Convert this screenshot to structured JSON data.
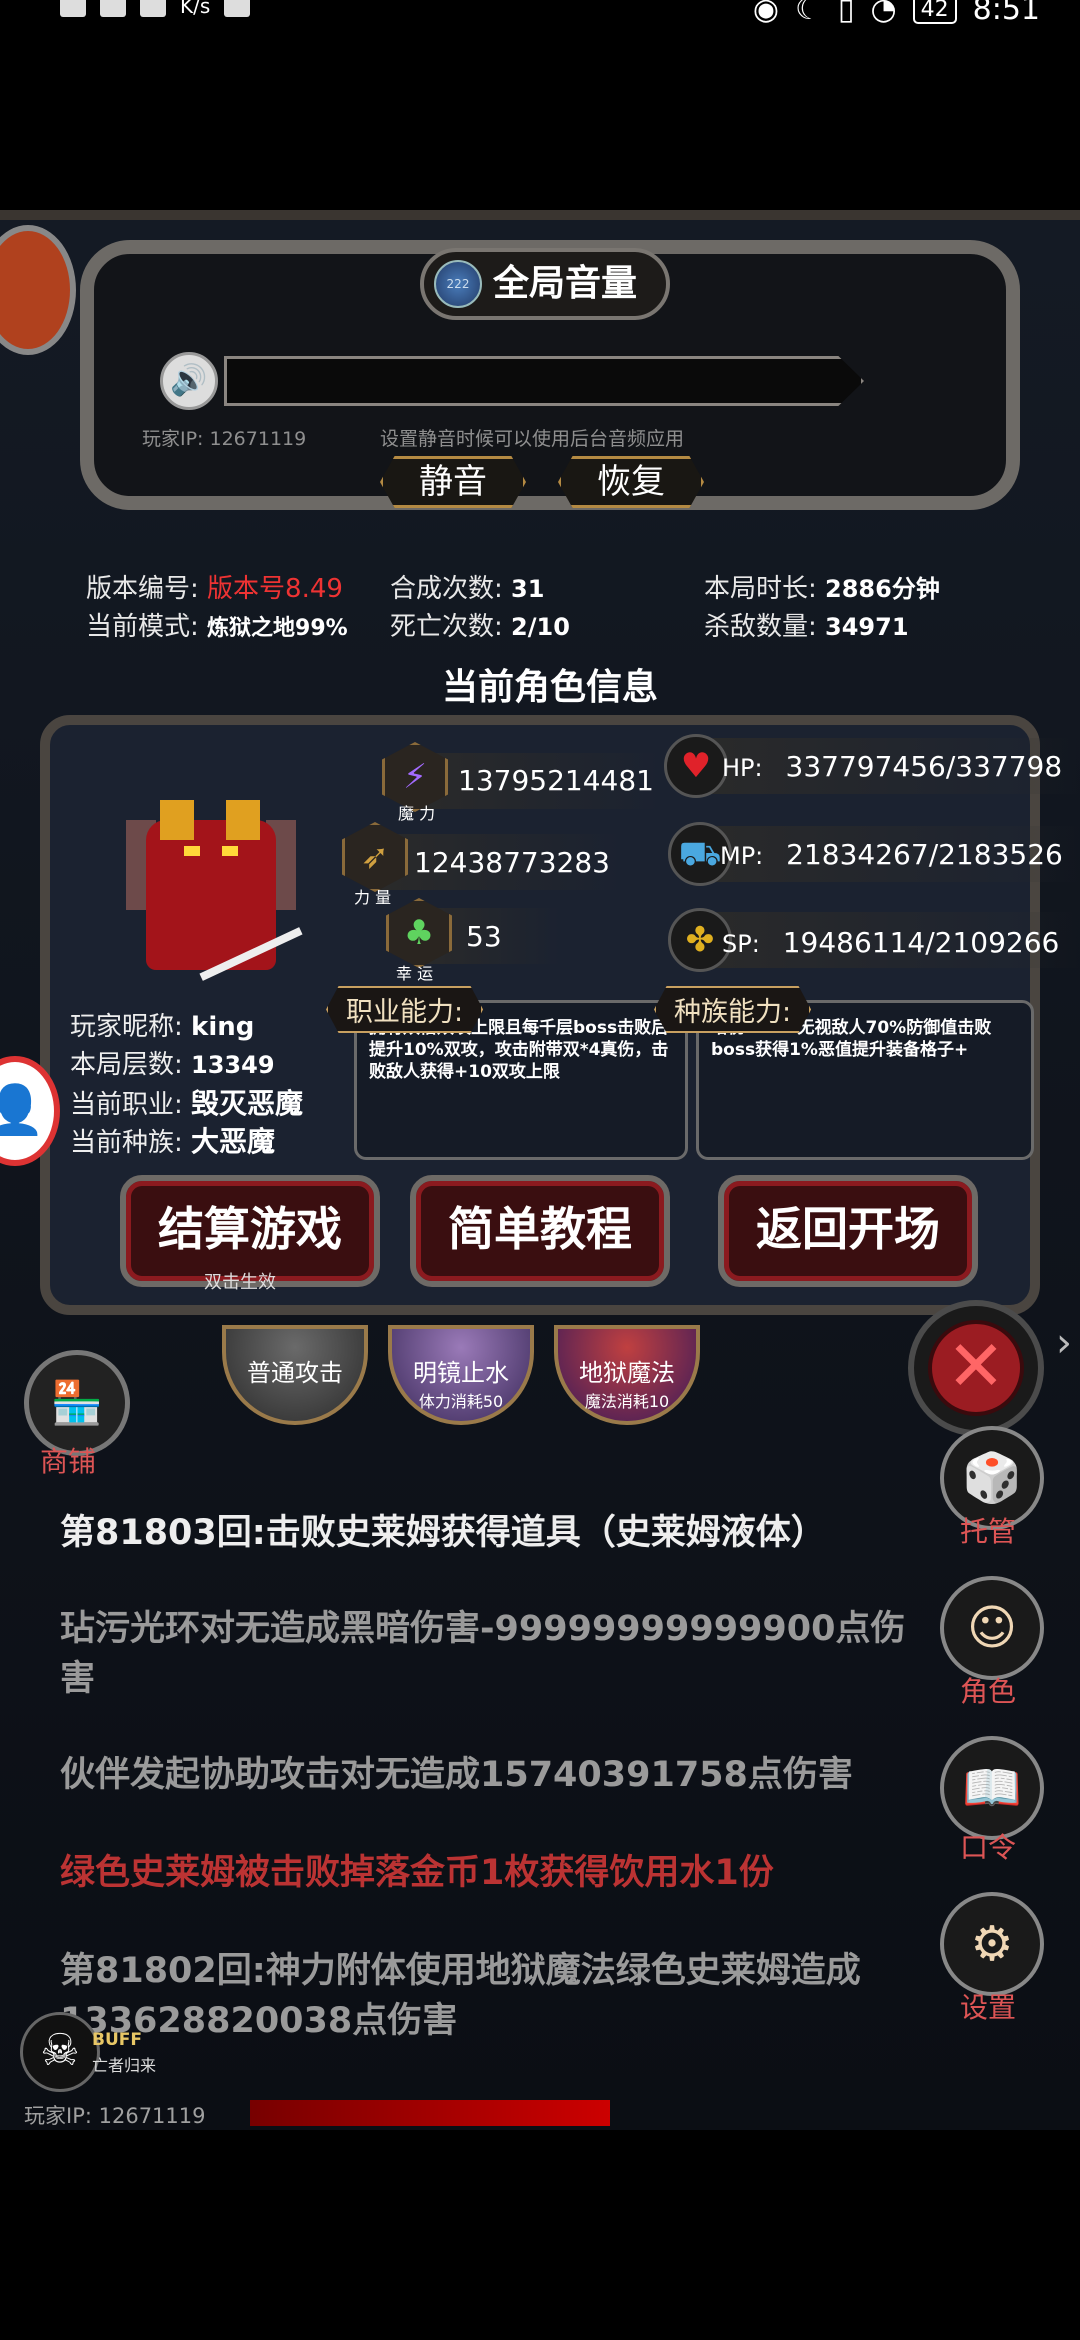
{
  "status_bar": {
    "net_speed": "K/s",
    "time": "8:51",
    "battery": "42"
  },
  "volume": {
    "title": "全局音量",
    "badge": "222",
    "player_ip": "玩家IP:  12671119",
    "hint": "设置静音时候可以使用后台音频应用",
    "mute_label": "静音",
    "restore_label": "恢复"
  },
  "stats": {
    "version_label": "版本编号:",
    "version_value": "版本号8.49",
    "merge_label": "合成次数:",
    "merge_value": "31",
    "duration_label": "本局时长:",
    "duration_value": "2886分钟",
    "mode_label": "当前模式:",
    "mode_value": "炼狱之地99%",
    "death_label": "死亡次数:",
    "death_value": "2/10",
    "kill_label": "杀敌数量:",
    "kill_value": "34971"
  },
  "character": {
    "section_title": "当前角色信息",
    "magic_value": "13795214481",
    "magic_caption": "魔 力",
    "strength_value": "12438773283",
    "strength_caption": "力 量",
    "luck_value": "53",
    "luck_caption": "幸 运",
    "hp_label": "HP:",
    "hp_value": "337797456/337798",
    "mp_label": "MP:",
    "mp_value": "21834267/2183526",
    "sp_label": "SP:",
    "sp_value": "19486114/2109266",
    "class_ability_label": "职业能力:",
    "class_ability_text": "拥有双倍双攻上限且每千层boss击败后提升10%双攻，攻击附带双*4真伤，击败敌人获得+10双攻上限",
    "race_ability_label": "种族能力:",
    "race_ability_text": "增伤200%无视敌人70%防御值击败boss获得1%恶值提升装备格子+",
    "nickname_label": "玩家昵称:",
    "nickname_value": "king",
    "floor_label": "本局层数:",
    "floor_value": "13349",
    "class_label": "当前职业:",
    "class_value": "毁灭恶魔",
    "race_label": "当前种族:",
    "race_value": "大恶魔"
  },
  "actions": {
    "settle_label": "结算游戏",
    "settle_sub": "双击生效",
    "tutorial_label": "简单教程",
    "return_label": "返回开场"
  },
  "skills": [
    {
      "name": "普通攻击",
      "cost": ""
    },
    {
      "name": "明镜止水",
      "cost": "体力消耗50"
    },
    {
      "name": "地狱魔法",
      "cost": "魔法消耗10"
    }
  ],
  "side": {
    "shop_label": "商铺",
    "auto_label": "托管",
    "role_label": "角色",
    "code_label": "口令",
    "settings_label": "设置"
  },
  "log": [
    {
      "text": "第81803回:击败史莱姆获得道具（史莱姆液体）",
      "style": "white"
    },
    {
      "text": "玷污光环对无造成黑暗伤害-99999999999900点伤害",
      "style": "grey"
    },
    {
      "text": "伙伴发起协助攻击对无造成15740391758点伤害",
      "style": "grey"
    },
    {
      "text": "绿色史莱姆被击败掉落金币1枚获得饮用水1份",
      "style": "red"
    },
    {
      "text": "第81802回:神力附体使用地狱魔法绿色史莱姆造成133628820038点伤害",
      "style": "grey"
    }
  ],
  "buff": {
    "label": "BUFF",
    "sub": "亡者归来"
  },
  "footer": {
    "player_ip": "玩家IP:  12671119"
  }
}
